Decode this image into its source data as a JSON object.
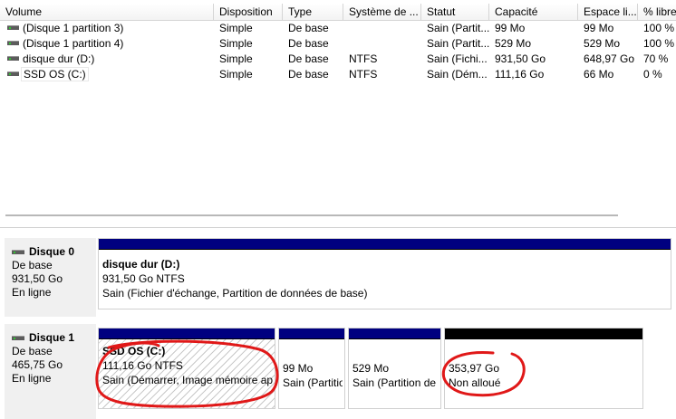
{
  "columns": {
    "volume": "Volume",
    "disposition": "Disposition",
    "type": "Type",
    "fs": "Système de ...",
    "status": "Statut",
    "capacity": "Capacité",
    "free": "Espace li...",
    "pct": "% libre"
  },
  "volumes": [
    {
      "name": "(Disque 1 partition 3)",
      "disposition": "Simple",
      "type": "De base",
      "fs": "",
      "status": "Sain (Partit...",
      "capacity": "99 Mo",
      "free": "99 Mo",
      "pct": "100 %"
    },
    {
      "name": "(Disque 1 partition 4)",
      "disposition": "Simple",
      "type": "De base",
      "fs": "",
      "status": "Sain (Partit...",
      "capacity": "529 Mo",
      "free": "529 Mo",
      "pct": "100 %"
    },
    {
      "name": "disque dur (D:)",
      "disposition": "Simple",
      "type": "De base",
      "fs": "NTFS",
      "status": "Sain (Fichi...",
      "capacity": "931,50 Go",
      "free": "648,97 Go",
      "pct": "70 %"
    },
    {
      "name": "SSD OS (C:)",
      "disposition": "Simple",
      "type": "De base",
      "fs": "NTFS",
      "status": "Sain (Dém...",
      "capacity": "111,16 Go",
      "free": "66 Mo",
      "pct": "0 %"
    }
  ],
  "disks": [
    {
      "name": "Disque 0",
      "kind": "De base",
      "size": "931,50 Go",
      "state": "En ligne",
      "partitions": [
        {
          "title": "disque dur  (D:)",
          "line1": "931,50 Go NTFS",
          "line2": "Sain (Fichier d'échange, Partition de données de base)"
        }
      ]
    },
    {
      "name": "Disque 1",
      "kind": "De base",
      "size": "465,75 Go",
      "state": "En ligne",
      "partitions": [
        {
          "title": "SSD OS  (C:)",
          "line1": "111,16 Go NTFS",
          "line2": "Sain (Démarrer, Image mémoire après incident, Partition principale)"
        },
        {
          "title": "",
          "line1": "99 Mo",
          "line2": "Sain (Partition système EFI)"
        },
        {
          "title": "",
          "line1": "529 Mo",
          "line2": "Sain (Partition de récupération)"
        },
        {
          "title": "",
          "line1": "353,97 Go",
          "line2": "Non alloué"
        }
      ]
    }
  ],
  "colors": {
    "primary_partition_bar": "#000080",
    "unallocated_bar": "#000000",
    "annotation_circle": "#e01818"
  }
}
